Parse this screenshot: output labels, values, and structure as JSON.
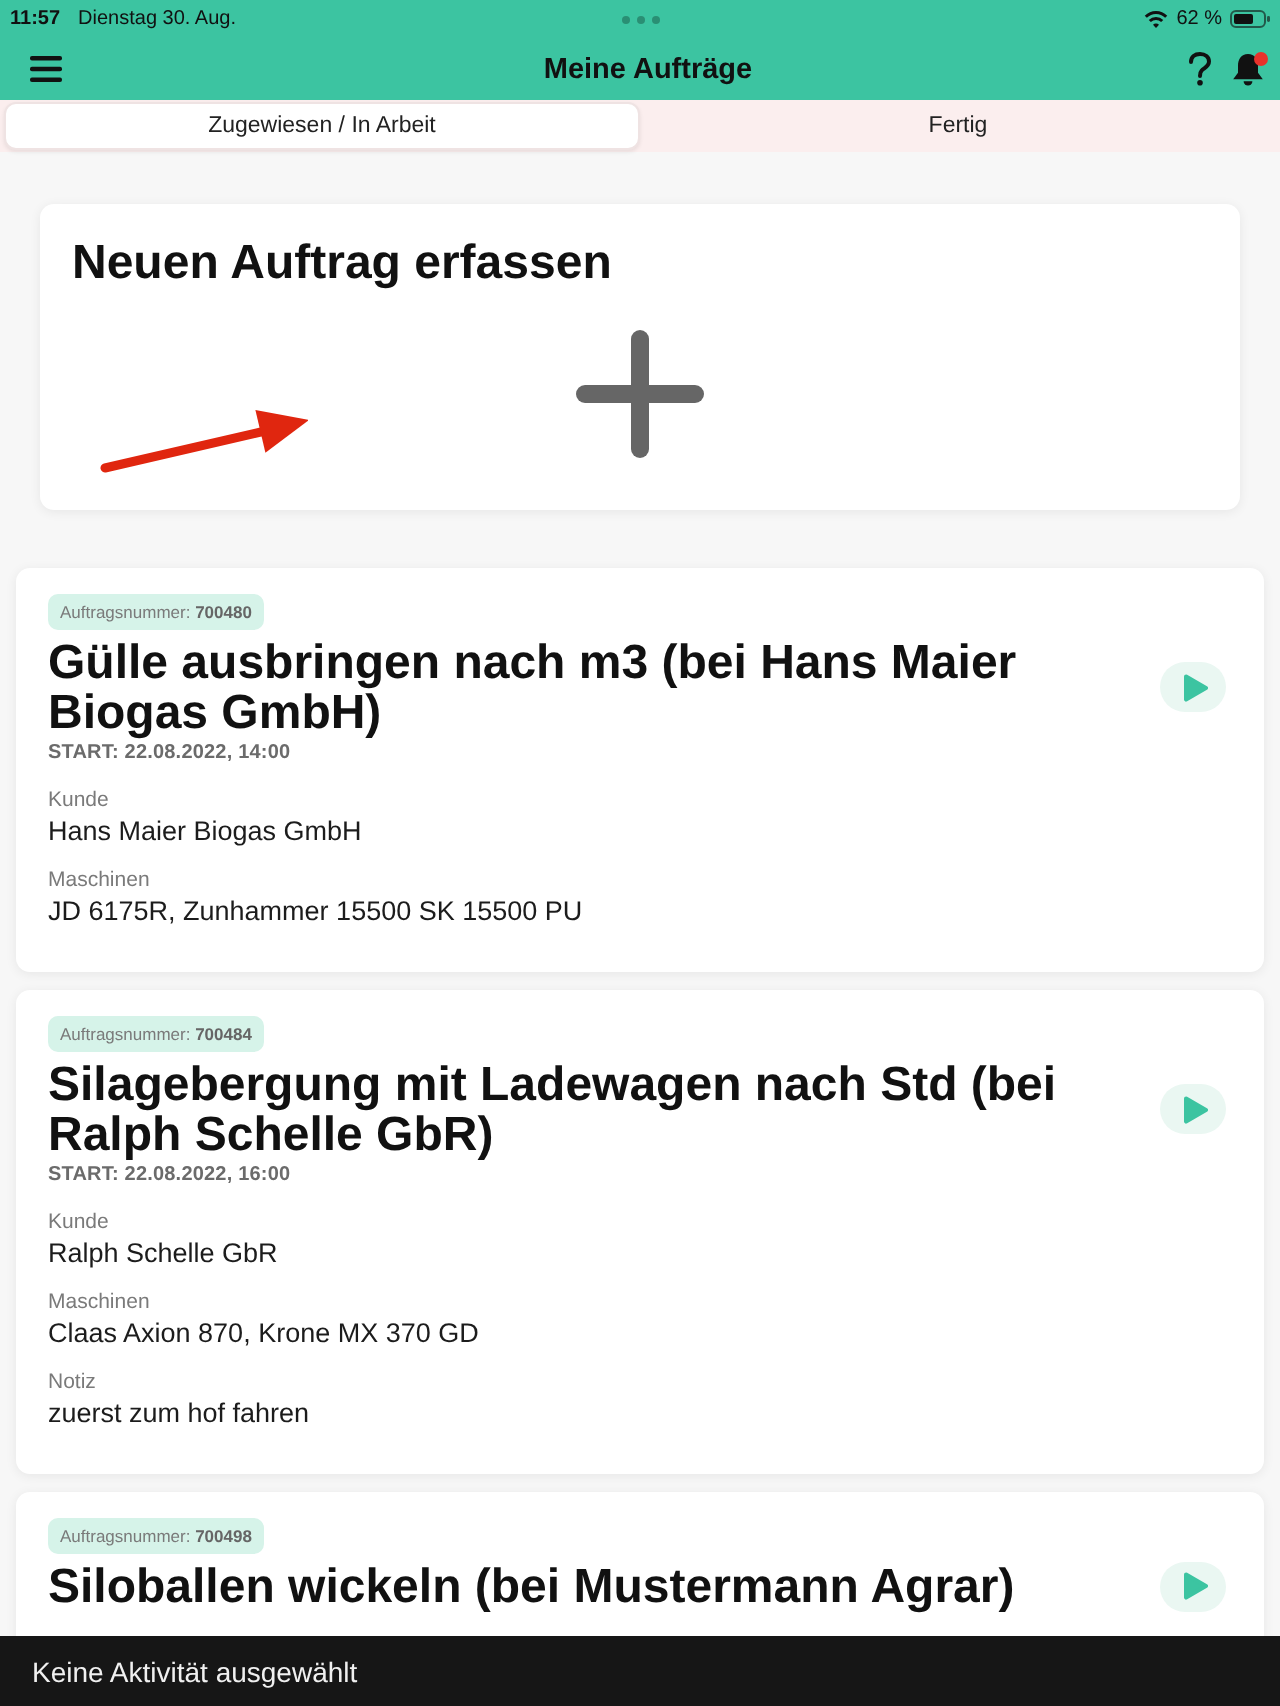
{
  "status_bar": {
    "time": "11:57",
    "date": "Dienstag 30. Aug.",
    "battery": "62 %"
  },
  "header": {
    "title": "Meine Aufträge",
    "has_notification": true
  },
  "tabs": [
    {
      "label": "Zugewiesen / In Arbeit",
      "selected": true
    },
    {
      "label": "Fertig",
      "selected": false
    }
  ],
  "new_order": {
    "title": "Neuen Auftrag erfassen"
  },
  "orders": [
    {
      "number": "Auftragsnummer: **700480**",
      "title": "Gülle ausbringen nach m3 (bei Hans Maier Biogas GmbH)",
      "start": "START: 22.08.2022, 14:00",
      "fields": [
        {
          "label": "Kunde",
          "value": "Hans Maier Biogas GmbH"
        },
        {
          "label": "Maschinen",
          "value": "JD 6175R, Zunhammer 15500 SK 15500 PU"
        }
      ]
    },
    {
      "number": "Auftragsnummer: **700484**",
      "title": "Silagebergung mit Ladewagen nach Std (bei Ralph Schelle GbR)",
      "start": "START: 22.08.2022, 16:00",
      "fields": [
        {
          "label": "Kunde",
          "value": "Ralph Schelle GbR"
        },
        {
          "label": "Maschinen",
          "value": "Claas Axion 870, Krone MX 370 GD"
        },
        {
          "label": "Notiz",
          "value": "zuerst zum hof fahren"
        }
      ]
    },
    {
      "number": "Auftragsnummer: **700498**",
      "title": "Siloballen wickeln (bei Mustermann Agrar)"
    }
  ],
  "activity_bar": {
    "text": "Keine Aktivität ausgewählt"
  }
}
